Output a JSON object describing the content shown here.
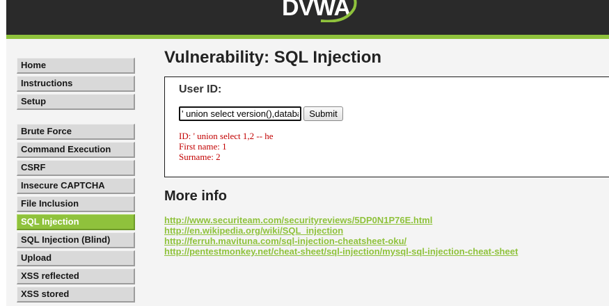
{
  "header": {
    "logo_text": "DVWA",
    "brand_color": "#8fc23c"
  },
  "sidebar": {
    "main_items": [
      {
        "label": "Home"
      },
      {
        "label": "Instructions"
      },
      {
        "label": "Setup"
      }
    ],
    "vuln_items": [
      {
        "label": "Brute Force"
      },
      {
        "label": "Command Execution"
      },
      {
        "label": "CSRF"
      },
      {
        "label": "Insecure CAPTCHA"
      },
      {
        "label": "File Inclusion"
      },
      {
        "label": "SQL Injection",
        "active": true
      },
      {
        "label": "SQL Injection (Blind)"
      },
      {
        "label": "Upload"
      },
      {
        "label": "XSS reflected"
      },
      {
        "label": "XSS stored"
      }
    ]
  },
  "main": {
    "title": "Vulnerability: SQL Injection",
    "form": {
      "label": "User ID:",
      "input_value": "' union select version(),databa",
      "submit_label": "Submit"
    },
    "result_lines": [
      "ID: ' union select 1,2 -- he",
      "First name: 1",
      "Surname: 2"
    ],
    "more_info": {
      "title": "More info",
      "links": [
        "http://www.securiteam.com/securityreviews/5DP0N1P76E.html",
        "http://en.wikipedia.org/wiki/SQL_injection",
        "http://ferruh.mavituna.com/sql-injection-cheatsheet-oku/",
        "http://pentestmonkey.net/cheat-sheet/sql-injection/mysql-sql-injection-cheat-sheet"
      ]
    }
  }
}
